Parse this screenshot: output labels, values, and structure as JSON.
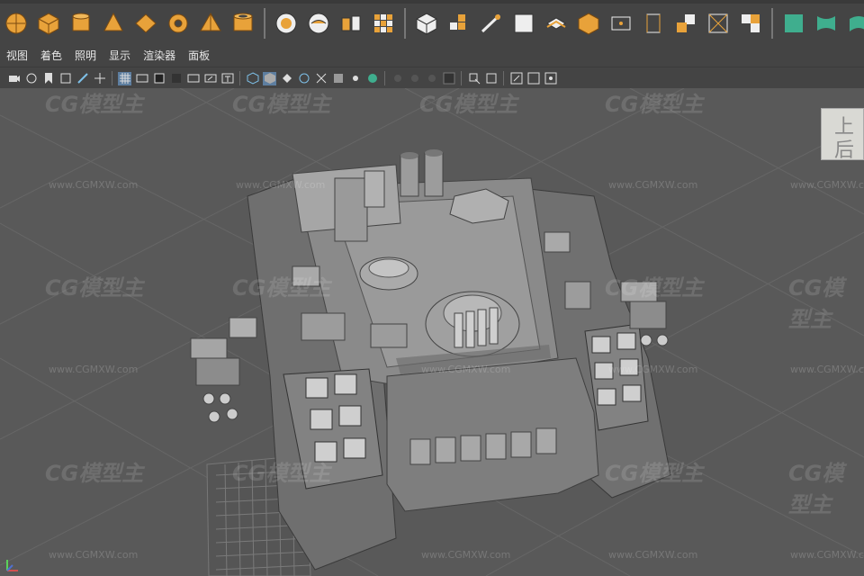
{
  "shelf": {
    "icons_group1": [
      "sphere-icon",
      "cube-icon",
      "cylinder-icon",
      "cone-icon",
      "plane-icon",
      "torus-icon",
      "pyramid-icon",
      "pipe-icon"
    ],
    "icons_group2": [
      "combine-icon",
      "separate-icon",
      "extract-icon",
      "smooth-icon",
      "mirror-icon",
      "bevel-icon",
      "bridge-icon",
      "fill-hole-icon",
      "multi-cut-icon",
      "target-weld-icon",
      "center-pivot-icon",
      "freeze-icon",
      "history-icon",
      "bounding-box-icon",
      "lattice-icon",
      "cluster-icon",
      "sculpt-icon"
    ],
    "icons_group3": [
      "uv-planar-icon",
      "uv-cylindrical-icon",
      "uv-spherical-icon",
      "uv-auto-icon"
    ],
    "accent_orange": "#e8a23a",
    "accent_teal": "#3fae8e"
  },
  "menu": {
    "view": "视图",
    "shading": "着色",
    "lighting": "照明",
    "show": "显示",
    "renderer": "渲染器",
    "panels": "面板"
  },
  "watermark": {
    "logo": "CG模型主",
    "url": "www.CGMXW.com"
  },
  "viewcube": {
    "top_char": "上",
    "front_char": "后"
  }
}
